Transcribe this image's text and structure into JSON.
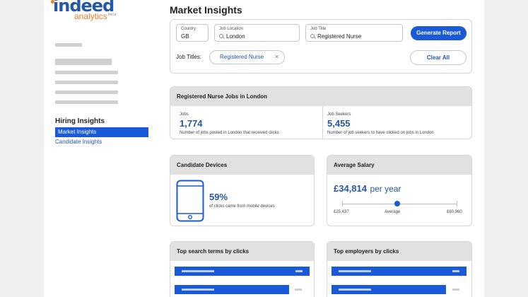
{
  "brand": {
    "name": "indeed",
    "product": "analytics",
    "tag": "beta"
  },
  "nav": {
    "heading": "Hiring Insights",
    "items": [
      {
        "label": "Market Insights",
        "active": true
      },
      {
        "label": "Candidate Insights",
        "active": false
      }
    ]
  },
  "page": {
    "title": "Market Insights"
  },
  "filters": {
    "country": {
      "label": "Country",
      "value": "GB"
    },
    "location": {
      "label": "Job Location",
      "value": "London"
    },
    "job_title": {
      "label": "Job Title",
      "value": "Registered Nurse"
    },
    "generate_label": "Generate Report",
    "job_titles_label": "Job Titles:",
    "chips": [
      "Registered Nurse"
    ],
    "clear_label": "Clear All"
  },
  "summary": {
    "title": "Registered Nurse Jobs in London",
    "jobs": {
      "label": "Jobs",
      "value": "1,774",
      "desc": "Number of jobs posted in London that received clicks"
    },
    "seekers": {
      "label": "Job Seekers",
      "value": "5,455",
      "desc": "Number of job seekers to have clicked on jobs in London"
    }
  },
  "devices": {
    "title": "Candidate Devices",
    "value": "59%",
    "desc": "of clicks came from mobile devices"
  },
  "salary": {
    "title": "Average Salary",
    "value": "£34,814",
    "period": "per year",
    "min": "£25,437",
    "avg_label": "Average",
    "max": "£60,960",
    "avg_position_fraction": 0.48
  },
  "search_terms": {
    "title": "Top search terms by clicks",
    "bar_fractions": [
      1.0,
      0.85
    ]
  },
  "employers": {
    "title": "Top employers by clicks",
    "bar_fractions": [
      1.0,
      0.85
    ]
  },
  "colors": {
    "accent": "#1a5ad9",
    "brand": "#2557a7",
    "logo_orange": "#f27b21",
    "card_header": "#e1e1e1"
  }
}
